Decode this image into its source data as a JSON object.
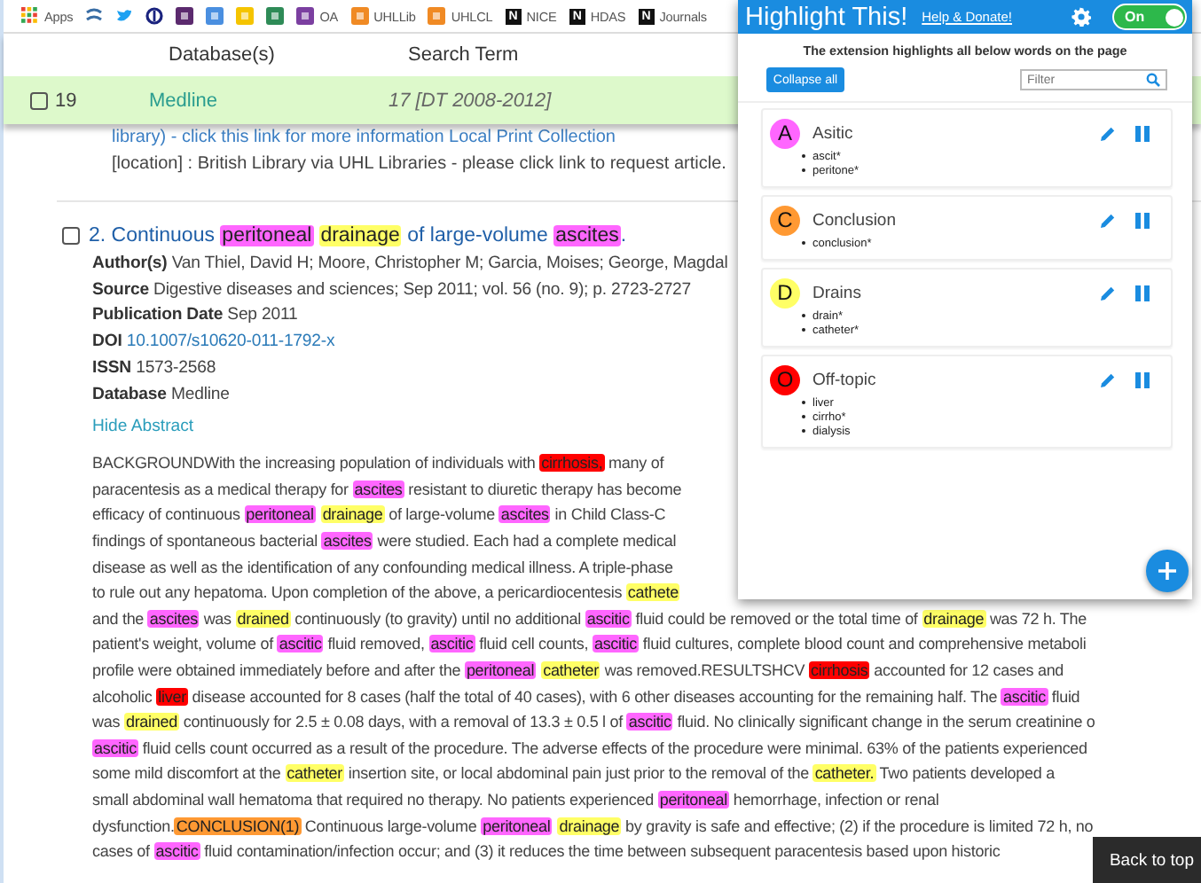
{
  "bookmarks": [
    {
      "kind": "grid",
      "label": "Apps"
    },
    {
      "kind": "swirl",
      "color": "#3a6ea5"
    },
    {
      "kind": "bird",
      "color": "#1da1f2"
    },
    {
      "kind": "ring",
      "color": "#1a237e"
    },
    {
      "kind": "square",
      "color": "#5b2a6e"
    },
    {
      "kind": "square",
      "color": "#4a8fe0"
    },
    {
      "kind": "square",
      "color": "#f5c400"
    },
    {
      "kind": "square",
      "color": "#2e8b57"
    },
    {
      "kind": "square",
      "color": "#7b3fa0",
      "label": "OA"
    },
    {
      "kind": "square",
      "color": "#f08a24",
      "label": "UHLLib"
    },
    {
      "kind": "square",
      "color": "#f08a24",
      "label": "UHLCL"
    },
    {
      "kind": "letter",
      "badge": "N",
      "label": "NICE"
    },
    {
      "kind": "letter",
      "badge": "N",
      "label": "HDAS"
    },
    {
      "kind": "letter",
      "badge": "N",
      "label": "Journals"
    }
  ],
  "results": {
    "columns": [
      "Database(s)",
      "Search Term"
    ],
    "row": {
      "checked": false,
      "number": "19",
      "database": "Medline",
      "search_term": "17 [DT 2008-2012]"
    }
  },
  "holdings": [
    {
      "kind": "link",
      "text": "library) - click this link for more information Local Print Collection"
    },
    {
      "kind": "plain",
      "text": "[location] : British Library via UHL Libraries - please click link to request article."
    }
  ],
  "article": {
    "checked": false,
    "title": [
      {
        "text": "2. Continuous "
      },
      {
        "text": "peritoneal",
        "color": "#ff66ff"
      },
      {
        "text": "drainage",
        "color": "#ffff66"
      },
      {
        "text": " of large-volume "
      },
      {
        "text": "ascites",
        "color": "#ff66ff"
      },
      {
        "text": "."
      }
    ],
    "fields": [
      {
        "label": "Author(s)",
        "value": "Van Thiel, David H; Moore, Christopher M; Garcia, Moises; George, Magdal",
        "kind": "plain"
      },
      {
        "label": "Source",
        "value": "Digestive diseases and sciences; Sep 2011; vol. 56 (no. 9); p. 2723-2727",
        "kind": "plain"
      },
      {
        "label": "Publication Date",
        "value": "Sep 2011",
        "kind": "plain"
      },
      {
        "label": "DOI",
        "value": "10.1007/s10620-011-1792-x",
        "kind": "link"
      },
      {
        "label": "ISSN",
        "value": "1573-2568",
        "kind": "plain"
      },
      {
        "label": "Database",
        "value": "Medline",
        "kind": "plain"
      }
    ],
    "toggle_link": "Hide Abstract",
    "abstract_lines": [
      [
        {
          "text": "BACKGROUNDWith the increasing population of individuals with "
        },
        {
          "text": "cirrhosis,",
          "color": "#ff0000"
        },
        {
          "text": " many of"
        }
      ],
      [
        {
          "text": "paracentesis as a medical therapy for "
        },
        {
          "text": "ascites",
          "color": "#ff66ff"
        },
        {
          "text": " resistant to diuretic therapy has become"
        }
      ],
      [
        {
          "text": "efficacy of continuous "
        },
        {
          "text": "peritoneal",
          "color": "#ff66ff"
        },
        {
          "text": "drainage",
          "color": "#ffff66"
        },
        {
          "text": " of large-volume "
        },
        {
          "text": "ascites",
          "color": "#ff66ff"
        },
        {
          "text": " in Child Class-C"
        }
      ],
      [
        {
          "text": "findings of spontaneous bacterial "
        },
        {
          "text": "ascites",
          "color": "#ff66ff"
        },
        {
          "text": " were studied. Each had a complete medical"
        }
      ],
      [
        {
          "text": "disease as well as the identification of any confounding medical illness. A triple-phase"
        }
      ],
      [
        {
          "text": "to rule out any hepatoma. Upon completion of the above, a pericardiocentesis "
        },
        {
          "text": "cathete",
          "color": "#ffff66"
        }
      ],
      [
        {
          "text": "and the "
        },
        {
          "text": "ascites",
          "color": "#ff66ff"
        },
        {
          "text": " was "
        },
        {
          "text": "drained",
          "color": "#ffff66"
        },
        {
          "text": " continuously (to gravity) until no additional "
        },
        {
          "text": "ascitic",
          "color": "#ff66ff"
        },
        {
          "text": " fluid could be removed or the total time of "
        },
        {
          "text": "drainage",
          "color": "#ffff66"
        },
        {
          "text": " was 72 h. The"
        }
      ],
      [
        {
          "text": "patient's weight, volume of "
        },
        {
          "text": "ascitic",
          "color": "#ff66ff"
        },
        {
          "text": " fluid removed, "
        },
        {
          "text": "ascitic",
          "color": "#ff66ff"
        },
        {
          "text": " fluid cell counts, "
        },
        {
          "text": "ascitic",
          "color": "#ff66ff"
        },
        {
          "text": " fluid cultures, complete blood count and comprehensive metaboli"
        }
      ],
      [
        {
          "text": "profile were obtained immediately before and after the "
        },
        {
          "text": "peritoneal",
          "color": "#ff66ff"
        },
        {
          "text": "catheter",
          "color": "#ffff66"
        },
        {
          "text": " was removed.RESULTSHCV "
        },
        {
          "text": "cirrhosis",
          "color": "#ff0000"
        },
        {
          "text": " accounted for 12 cases and"
        }
      ],
      [
        {
          "text": "alcoholic "
        },
        {
          "text": "liver",
          "color": "#ff0000"
        },
        {
          "text": " disease accounted for 8 cases (half the total of 40 cases), with 6 other diseases accounting for the remaining half. The "
        },
        {
          "text": "ascitic",
          "color": "#ff66ff"
        },
        {
          "text": " fluid"
        }
      ],
      [
        {
          "text": "was "
        },
        {
          "text": "drained",
          "color": "#ffff66"
        },
        {
          "text": " continuously for 2.5 ± 0.08 days, with a removal of 13.3 ± 0.5 l of "
        },
        {
          "text": "ascitic",
          "color": "#ff66ff"
        },
        {
          "text": " fluid. No clinically significant change in the serum creatinine o"
        }
      ],
      [
        {
          "text": "ascitic",
          "color": "#ff66ff"
        },
        {
          "text": " fluid cells count occurred as a result of the procedure. The adverse effects of the procedure were minimal. 63% of the patients experienced"
        }
      ],
      [
        {
          "text": "some mild discomfort at the "
        },
        {
          "text": "catheter",
          "color": "#ffff66"
        },
        {
          "text": " insertion site, or local abdominal pain just prior to the removal of the "
        },
        {
          "text": "catheter.",
          "color": "#ffff66"
        },
        {
          "text": " Two patients developed a"
        }
      ],
      [
        {
          "text": "small abdominal wall hematoma that required no therapy. No patients experienced "
        },
        {
          "text": "peritoneal",
          "color": "#ff66ff"
        },
        {
          "text": " hemorrhage, infection or renal"
        }
      ],
      [
        {
          "text": "dysfunction."
        },
        {
          "text": "CONCLUSION(1)",
          "color": "#ff9933"
        },
        {
          "text": " Continuous large-volume "
        },
        {
          "text": "peritoneal",
          "color": "#ff66ff"
        },
        {
          "text": "drainage",
          "color": "#ffff66"
        },
        {
          "text": " by gravity is safe and effective; (2) if the procedure is limited 72 h, no"
        }
      ],
      [
        {
          "text": "cases of "
        },
        {
          "text": "ascitic",
          "color": "#ff66ff"
        },
        {
          "text": " fluid contamination/infection occur; and (3) it reduces the time between subsequent paracentesis based upon historic"
        }
      ]
    ]
  },
  "popup": {
    "title": "Highlight This!",
    "help_link": "Help & Donate!",
    "toggle": {
      "label": "On",
      "on": true
    },
    "intro": "The extension highlights all below words on the page",
    "collapse_button": "Collapse all",
    "filter": {
      "placeholder": "Filter"
    },
    "groups": [
      {
        "letter": "A",
        "name": "Asitic",
        "color": "#ff66ff",
        "words": [
          "ascit*",
          "peritone*"
        ]
      },
      {
        "letter": "C",
        "name": "Conclusion",
        "color": "#ff9933",
        "words": [
          "conclusion*"
        ]
      },
      {
        "letter": "D",
        "name": "Drains",
        "color": "#ffff66",
        "words": [
          "drain*",
          "catheter*"
        ]
      },
      {
        "letter": "O",
        "name": "Off-topic",
        "color": "#ff0000",
        "words": [
          "liver",
          "cirrho*",
          "dialysis"
        ]
      }
    ]
  },
  "back_to_top": "Back to top"
}
